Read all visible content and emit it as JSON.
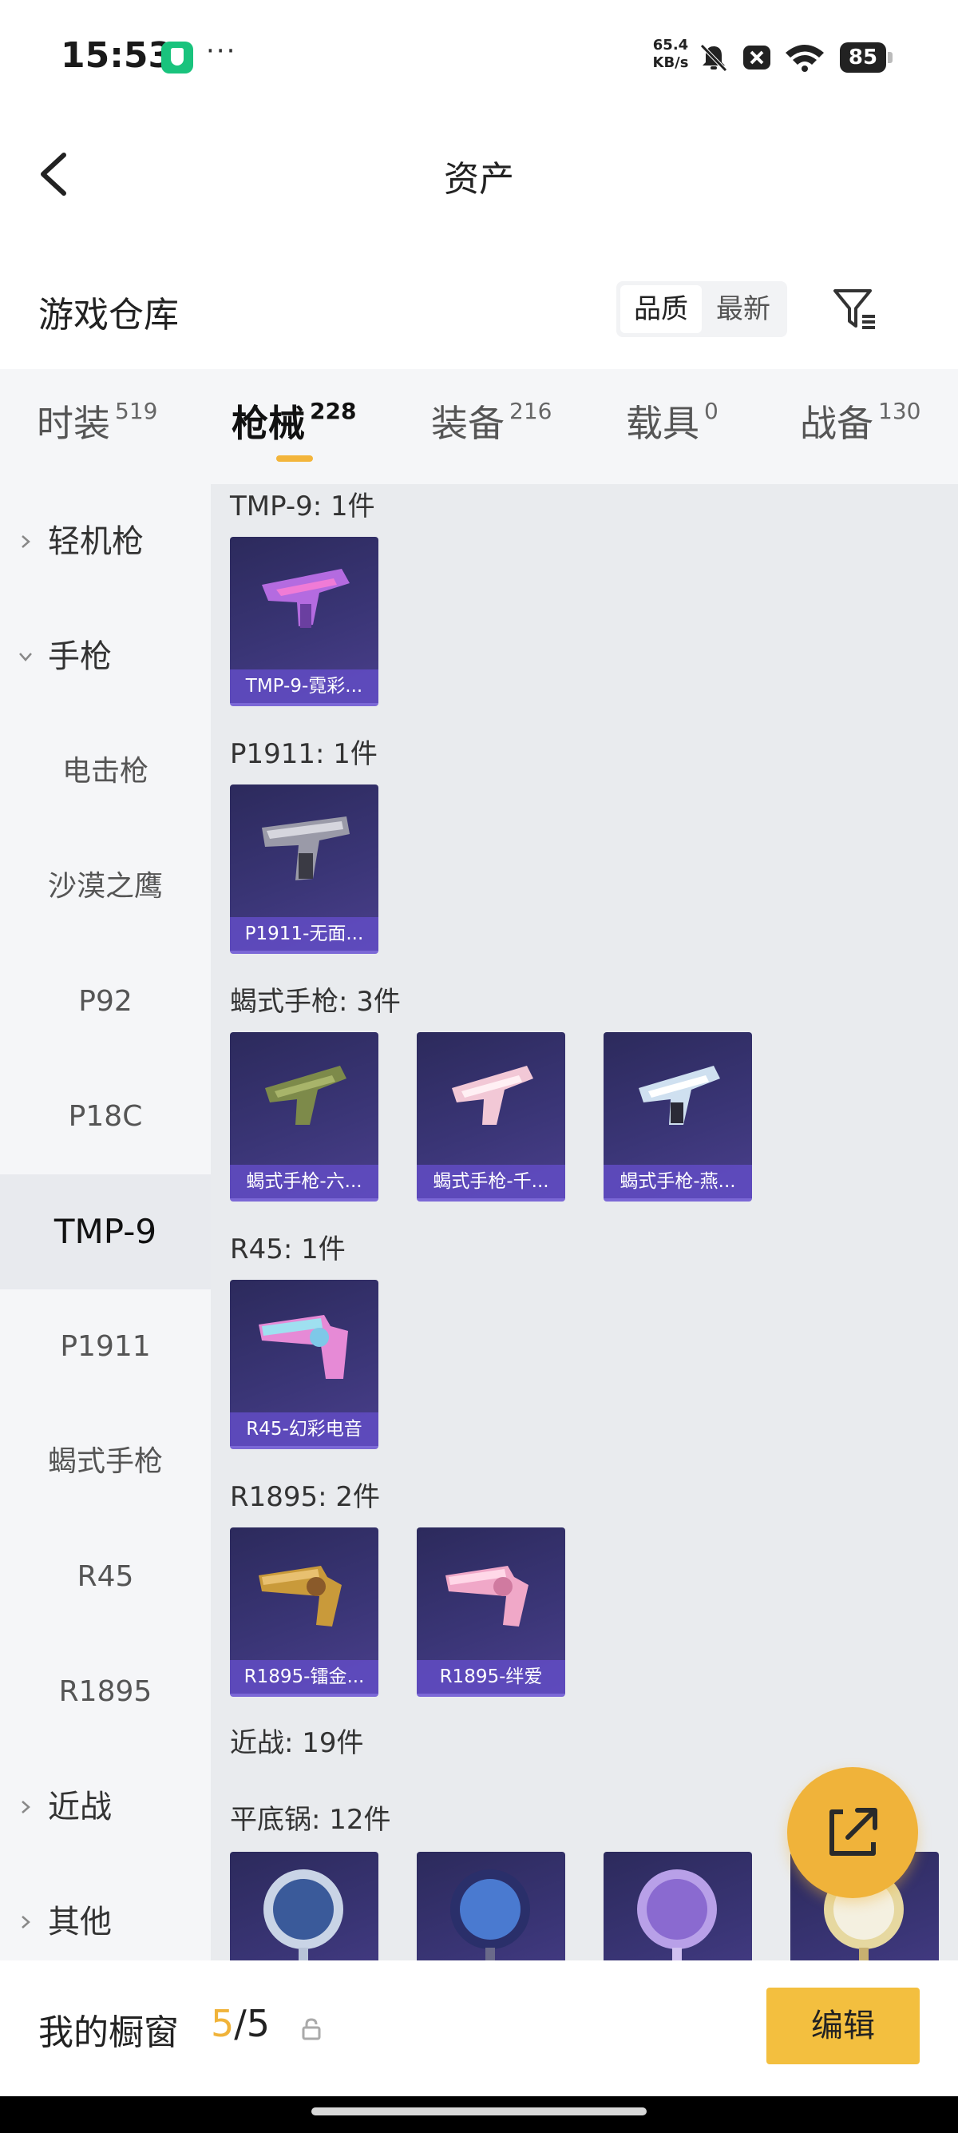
{
  "status_bar": {
    "time": "15:53",
    "net_speed_value": "65.4",
    "net_speed_unit": "KB/s",
    "battery": "85",
    "overflow": "···",
    "icons": [
      "shield-icon",
      "bell-muted-icon",
      "sim-x-icon",
      "wifi-icon",
      "battery-icon"
    ]
  },
  "header": {
    "title": "资产",
    "section_title": "游戏仓库",
    "sort_options": [
      "品质",
      "最新"
    ],
    "selected_sort": "品质"
  },
  "tabs": [
    {
      "label": "时装",
      "count": "519"
    },
    {
      "label": "枪械",
      "count": "228"
    },
    {
      "label": "装备",
      "count": "216"
    },
    {
      "label": "载具",
      "count": "0"
    },
    {
      "label": "战备",
      "count": "130"
    }
  ],
  "active_tab": "枪械",
  "sidebar": {
    "items": [
      {
        "label": "轻机枪",
        "type": "group",
        "expanded": false
      },
      {
        "label": "手枪",
        "type": "group",
        "expanded": true
      },
      {
        "label": "电击枪",
        "type": "sub"
      },
      {
        "label": "沙漠之鹰",
        "type": "sub"
      },
      {
        "label": "P92",
        "type": "sub"
      },
      {
        "label": "P18C",
        "type": "sub"
      },
      {
        "label": "TMP-9",
        "type": "sub",
        "active": true
      },
      {
        "label": "P1911",
        "type": "sub"
      },
      {
        "label": "蝎式手枪",
        "type": "sub"
      },
      {
        "label": "R45",
        "type": "sub"
      },
      {
        "label": "R1895",
        "type": "sub"
      },
      {
        "label": "近战",
        "type": "group",
        "expanded": false
      },
      {
        "label": "其他",
        "type": "group",
        "expanded": false
      }
    ]
  },
  "content": {
    "groups": [
      {
        "heading": "TMP-9: 1件",
        "items": [
          "TMP-9-霓彩..."
        ]
      },
      {
        "heading": "P1911: 1件",
        "items": [
          "P1911-无面..."
        ]
      },
      {
        "heading": "蝎式手枪: 3件",
        "items": [
          "蝎式手枪-六...",
          "蝎式手枪-千...",
          "蝎式手枪-燕..."
        ]
      },
      {
        "heading": "R45: 1件",
        "items": [
          "R45-幻彩电音"
        ]
      },
      {
        "heading": "R1895: 2件",
        "items": [
          "R1895-镭金...",
          "R1895-绊爱"
        ]
      },
      {
        "heading": "近战: 19件",
        "items": []
      },
      {
        "heading": "平底锅: 12件",
        "items": [
          "",
          "",
          "",
          ""
        ]
      }
    ]
  },
  "bottom_bar": {
    "label": "我的橱窗",
    "count_current": "5",
    "count_total": "/5",
    "edit_label": "编辑"
  },
  "colors": {
    "accent": "#f3bf3f",
    "card_bg": "#3a3576",
    "card_caption": "#624cc4",
    "sidebar_bg": "#f5f6f8",
    "content_bg": "#e9ebee"
  }
}
